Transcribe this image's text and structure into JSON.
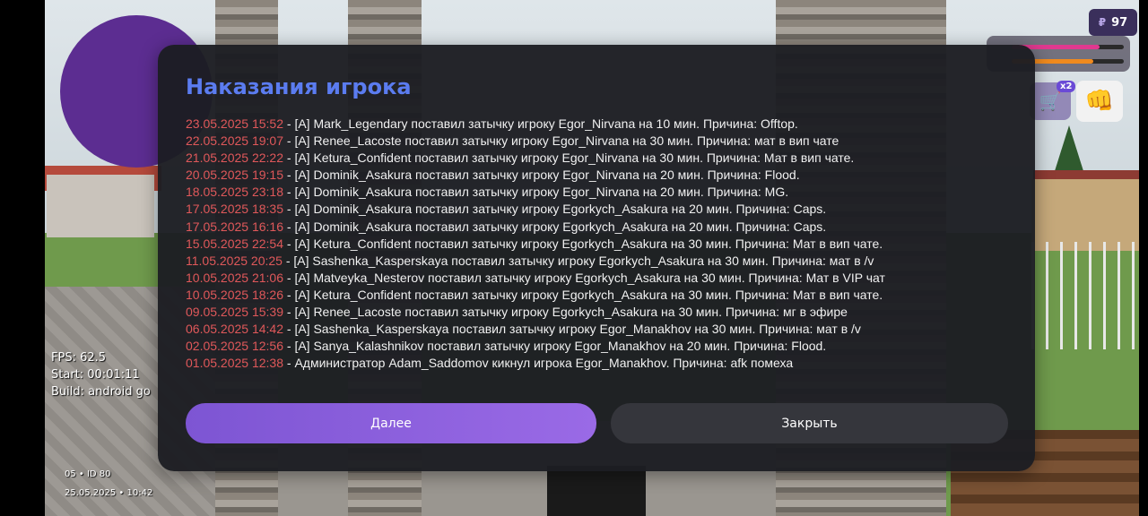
{
  "hud": {
    "money": "97",
    "money_symbol": "₽",
    "multiplier": "x2",
    "health_fraction": 0.78,
    "hunger_fraction": 0.73,
    "colors": {
      "health": "#e0398f",
      "hunger": "#f08a1e",
      "accent": "#5b7cf0",
      "date_red": "#e0585a"
    }
  },
  "stats": {
    "fps": "FPS: 62.5",
    "start": "Start: 00:01:11",
    "build": "Build: android go"
  },
  "footer": {
    "server": "05 • ID 80",
    "datetime": "25.05.2025 • 10:42"
  },
  "modal": {
    "title": "Наказания игрока",
    "entries": [
      {
        "date": "23.05.2025 15:52",
        "text": " - [A] Mark_Legendary поставил затычку игроку Egor_Nirvana на 10 мин. Причина: Offtop."
      },
      {
        "date": "22.05.2025 19:07",
        "text": " - [A] Renee_Lacoste поставил затычку игроку Egor_Nirvana на 30 мин. Причина: мат в вип чате"
      },
      {
        "date": "21.05.2025 22:22",
        "text": " - [A] Ketura_Confident поставил затычку игроку Egor_Nirvana на 30 мин. Причина: Мат в вип чате."
      },
      {
        "date": "20.05.2025 19:15",
        "text": " - [A] Dominik_Asakura поставил затычку игроку Egor_Nirvana на 20 мин. Причина: Flood."
      },
      {
        "date": "18.05.2025 23:18",
        "text": " - [A] Dominik_Asakura поставил затычку игроку Egor_Nirvana на 20 мин. Причина: MG."
      },
      {
        "date": "17.05.2025 18:35",
        "text": " - [A] Dominik_Asakura поставил затычку игроку Egorkych_Asakura на 20 мин. Причина: Caps."
      },
      {
        "date": "17.05.2025 16:16",
        "text": " - [A] Dominik_Asakura поставил затычку игроку Egorkych_Asakura на 20 мин. Причина: Caps."
      },
      {
        "date": "15.05.2025 22:54",
        "text": " - [A] Ketura_Confident поставил затычку игроку Egorkych_Asakura на 30 мин. Причина: Мат в вип чате."
      },
      {
        "date": "11.05.2025 20:25",
        "text": " - [A] Sashenka_Kasperskaya поставил затычку игроку Egorkych_Asakura на 30 мин. Причина: мат в /v"
      },
      {
        "date": "10.05.2025 21:06",
        "text": " - [A] Matveyka_Nesterov поставил затычку игроку Egorkych_Asakura на 30 мин. Причина: Мат в VIP чат"
      },
      {
        "date": "10.05.2025 18:26",
        "text": " - [A] Ketura_Confident поставил затычку игроку Egorkych_Asakura на 30 мин. Причина: Мат в вип чате."
      },
      {
        "date": "09.05.2025 15:39",
        "text": " - [A] Renee_Lacoste поставил затычку игроку Egorkych_Asakura на 30 мин. Причина: мг в эфире"
      },
      {
        "date": "06.05.2025 14:42",
        "text": " - [A] Sashenka_Kasperskaya поставил затычку игроку Egor_Manakhov на 30 мин. Причина: мат в /v"
      },
      {
        "date": "02.05.2025 12:56",
        "text": " - [A] Sanya_Kalashnikov поставил затычку игроку Egor_Manakhov на 20 мин. Причина: Flood."
      },
      {
        "date": "01.05.2025 12:38",
        "text": " - Администратор Adam_Saddomov кикнул игрока Egor_Manakhov. Причина: afk помеха"
      }
    ],
    "next_label": "Далее",
    "close_label": "Закрыть"
  }
}
